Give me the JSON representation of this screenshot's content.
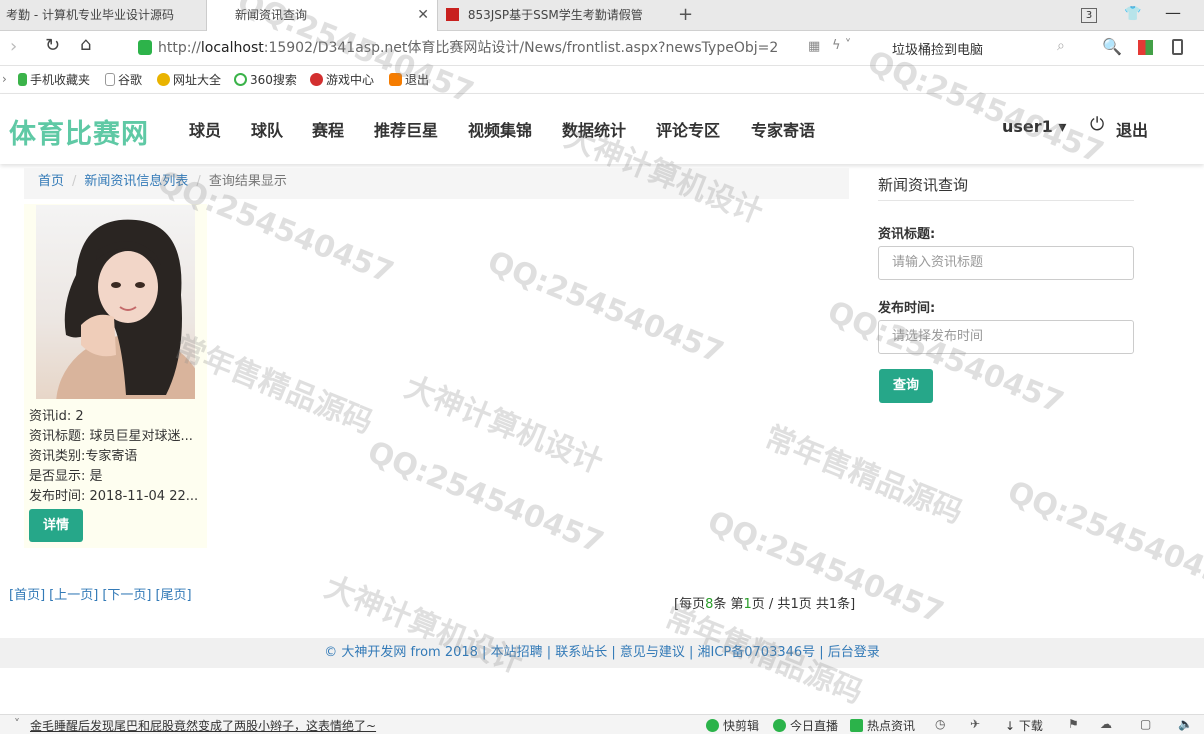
{
  "browser": {
    "tabs": [
      {
        "title": "考勤 - 计算机专业毕业设计源码"
      },
      {
        "title": "新闻资讯查询"
      },
      {
        "title": "853JSP基于SSM学生考勤请假管"
      }
    ],
    "tab_count": "3",
    "url_prefix": "http://",
    "url_host": "localhost",
    "url_rest": ":15902/D341asp.net体育比赛网站设计/News/frontlist.aspx?newsTypeObj=2",
    "search_hint": "垃圾桶捡到电脑",
    "bookmarks": [
      "手机收藏夹",
      "谷歌",
      "网址大全",
      "360搜索",
      "游戏中心",
      "退出"
    ]
  },
  "site": {
    "logo": "体育比赛网",
    "nav": [
      "球员",
      "球队",
      "赛程",
      "推荐巨星",
      "视频集锦",
      "数据统计",
      "评论专区",
      "专家寄语"
    ],
    "user": "user1 ▾",
    "logout": "退出"
  },
  "breadcrumb": {
    "home": "首页",
    "list": "新闻资讯信息列表",
    "current": "查询结果显示"
  },
  "card": {
    "lines": [
      "资讯id: 2",
      "资讯标题: 球员巨星对球迷...",
      "资讯类别:专家寄语",
      "是否显示: 是",
      "发布时间: 2018-11-04 22..."
    ],
    "detail_button": "详情"
  },
  "sidebar": {
    "title": "新闻资讯查询",
    "title_label": "资讯标题:",
    "title_placeholder": "请输入资讯标题",
    "time_label": "发布时间:",
    "time_placeholder": "请选择发布时间",
    "query_button": "查询"
  },
  "pager": {
    "links": [
      "[首页]",
      "[上一页]",
      "[下一页]",
      "[尾页]"
    ],
    "info_pre": "[每页",
    "per_page": "8",
    "info_mid": "条 第",
    "page": "1",
    "info_mid2": "页 / 共",
    "pages": "1",
    "info_mid3": "页 共",
    "total": "1",
    "info_post": "条]"
  },
  "footer": "© 大神开发网 from 2018 | 本站招聘 | 联系站长 | 意见与建议 | 湘ICP备0703346号 | 后台登录",
  "statusbar": {
    "news": "金毛睡醒后发现尾巴和屁股竟然变成了两股小辫子，这表情绝了~",
    "items": [
      "快剪辑",
      "今日直播",
      "热点资讯",
      "下载"
    ]
  },
  "watermarks": [
    "QQ:254540457",
    "大神计算机设计",
    "常年售精品源码"
  ]
}
